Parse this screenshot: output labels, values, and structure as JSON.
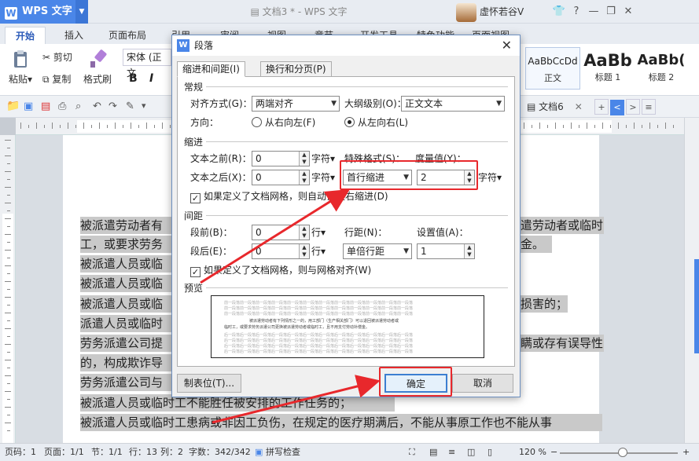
{
  "app": {
    "name": "WPS 文字",
    "logo_letter": "W",
    "document_title": "文档3 * - WPS 文字",
    "user_name": "虚怀若谷",
    "user_caret": "V"
  },
  "title_icons": [
    "shirt-icon",
    "help-icon",
    "minimize-icon",
    "restore-icon",
    "close-icon"
  ],
  "title_icon_glyphs": [
    "👕",
    "?",
    "—",
    "❐",
    "✕"
  ],
  "ribbon_tabs": [
    "开始",
    "插入",
    "页面布局",
    "引用",
    "审阅",
    "视图",
    "章节",
    "开发工具",
    "特色功能",
    "页面视图"
  ],
  "ribbon": {
    "paste": "粘贴",
    "cut": "剪切",
    "copy": "复制",
    "format_painter": "格式刷",
    "font_name": "宋体 (正文",
    "format_buttons": [
      "B",
      "I"
    ],
    "styles": [
      {
        "preview": "AaBbCcDd",
        "label": "正文"
      },
      {
        "preview": "AaBb",
        "label": "标题 1"
      },
      {
        "preview": "AaBb(",
        "label": "标题 2"
      }
    ]
  },
  "quick_bar": {
    "doc_tab": "文档6",
    "nav": [
      "+",
      "<",
      ">",
      "≡"
    ]
  },
  "document_lines": [
    "被派遣劳动者有",
    "工，或要求劳务",
    "被派遣人员或临",
    "被派遣人员或临",
    "被派遣人员或临",
    "派遣人员或临时",
    "劳务派遣公司提",
    "的，构成欺诈导",
    "劳务派遣公司与",
    "被派遣人员或临时工不能胜任被安排的工作任务的；",
    "被派遣人员或临时工患病或非因工负伤，在规定的医疗期满后，不能从事原工作也不能从事"
  ],
  "document_right_lines": [
    {
      "text": "遣劳动者或临时",
      "row": 0
    },
    {
      "text": "金。",
      "row": 1
    },
    {
      "text": "损害的；",
      "row": 4
    },
    {
      "text": "瞒或存有误导性",
      "row": 6
    }
  ],
  "dialog": {
    "title": "段落",
    "tabs": [
      "缩进和间距(I)",
      "换行和分页(P)"
    ],
    "general": {
      "section": "常规",
      "align_label": "对齐方式(G)：",
      "align_value": "两端对齐",
      "outline_label": "大纲级别(O)：",
      "outline_value": "正文文本",
      "direction_label": "方向：",
      "rtl": "从右向左(F)",
      "ltr": "从左向右(L)"
    },
    "indent": {
      "section": "缩进",
      "before_label": "文本之前(R)：",
      "before_value": "0",
      "after_label": "文本之后(X)：",
      "after_value": "0",
      "unit": "字符▾",
      "special_label": "特殊格式(S)：",
      "special_value": "首行缩进",
      "measure_label": "度量值(Y)：",
      "measure_value": "2",
      "grid_check": "如果定义了文档网格，则自动调整右缩进(D)"
    },
    "spacing": {
      "section": "间距",
      "before_label": "段前(B)：",
      "before_value": "0",
      "after_label": "段后(E)：",
      "after_value": "0",
      "unit": "行▾",
      "line_label": "行距(N)：",
      "line_value": "单倍行距",
      "set_label": "设置值(A)：",
      "set_value": "1",
      "grid_check": "如果定义了文档网格，则与网格对齐(W)"
    },
    "preview": {
      "section": "预览",
      "gray_line": "前一段落前一段落前一段落前一段落前一段落前一段落前一段落前一段落前一段落前一段落前一段落前一段落",
      "body_line1": "被派遣劳动者有下列情形之一的，用工部门（生产相关部门）可以退回被派遣劳动者或",
      "body_line2": "临时工，或要求劳务派遣公司更换被派遣劳动者或临时工，且不用支付劳动补偿金。",
      "after_line": "后一段落后一段落后一段落后一段落后一段落后一段落后一段落后一段落后一段落后一段落后一段落后一段落"
    },
    "tab_stops_button": "制表位(T)...",
    "ok": "确定",
    "cancel": "取消"
  },
  "status": {
    "page_code": "页码：1",
    "pages": "页面：1/1",
    "section": "节：1/1",
    "row": "行：13",
    "col": "列：2",
    "words": "字数：342/342",
    "spell": "拼写检查",
    "zoom": "120 %"
  },
  "colors": {
    "accent": "#4a86e8",
    "highlight_red": "#e8282c"
  }
}
